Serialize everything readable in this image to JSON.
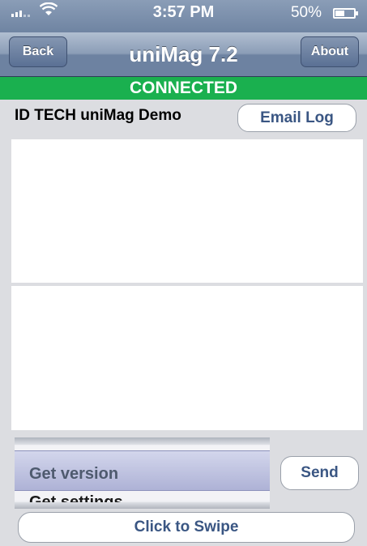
{
  "status_bar": {
    "time": "3:57 PM",
    "battery": "50%",
    "icons": {
      "signal": "signal-bars-icon",
      "wifi": "wifi-icon",
      "battery": "battery-icon"
    }
  },
  "navbar": {
    "title": "uniMag 7.2",
    "back_label": "Back",
    "about_label": "About"
  },
  "connection": {
    "status": "CONNECTED",
    "color": "#1ab04f"
  },
  "demo": {
    "label": "ID TECH uniMag Demo",
    "email_log_label": "Email Log"
  },
  "picker": {
    "options": [
      "Get version",
      "Get settings"
    ],
    "selected": "Get version"
  },
  "actions": {
    "send_label": "Send",
    "swipe_label": "Click to Swipe"
  }
}
